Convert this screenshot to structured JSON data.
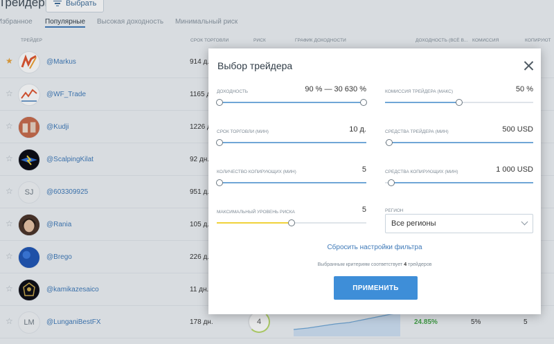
{
  "page": {
    "title": "Трейдеры",
    "choose_button": "Выбрать",
    "tabs": [
      "Избранное",
      "Популярные",
      "Высокая доходность",
      "Минимальный риск"
    ],
    "active_tab": "Популярные",
    "columns": [
      "ТРЕЙДЕР",
      "СРОК ТОРГОВЛИ",
      "РИСК",
      "ГРАФИК ДОХОДНОСТИ",
      "ДОХОДНОСТЬ (ВСЁ В...",
      "КОМИССИЯ",
      "КОПИРУЮТ"
    ],
    "traders": [
      {
        "name": "@Markus",
        "days": "914 д.",
        "favorite": true
      },
      {
        "name": "@WF_Trade",
        "days": "1165 д.",
        "favorite": false
      },
      {
        "name": "@Kudji",
        "days": "1226 д.",
        "favorite": false
      },
      {
        "name": "@ScalpingKilat",
        "days": "92 дн.",
        "favorite": false
      },
      {
        "name": "@603309925",
        "days": "951 д.",
        "favorite": false,
        "initials": "SJ"
      },
      {
        "name": "@Rania",
        "days": "105 д.",
        "favorite": false
      },
      {
        "name": "@Brego",
        "days": "226 д.",
        "favorite": false
      },
      {
        "name": "@kamikazesaico",
        "days": "11 дн.",
        "favorite": false
      },
      {
        "name": "@LunganiBestFX",
        "days": "178 дн.",
        "favorite": false,
        "initials": "LM",
        "risk": "4",
        "yield": "24.85%",
        "commission": "5%",
        "copiers": "5"
      }
    ]
  },
  "modal": {
    "title": "Выбор трейдера",
    "filters": {
      "yield": {
        "label": "ДОХОДНОСТЬ",
        "value": "90 % — 30 630 %",
        "low": 0.0,
        "high": 1.0
      },
      "commission": {
        "label": "КОМИССИЯ ТРЕЙДЕРА (МАКС)",
        "value": "50 %",
        "level": 0.5
      },
      "period": {
        "label": "СРОК ТОРГОВЛИ (МИН)",
        "value": "10 д.",
        "level": 0.0
      },
      "trader_funds": {
        "label": "СРЕДСТВА ТРЕЙДЕРА (МИН)",
        "value": "500 USD",
        "level": 0.02
      },
      "copiers": {
        "label": "КОЛИЧЕСТВО КОПИРУЮЩИХ (МИН)",
        "value": "5",
        "level": 0.0
      },
      "copier_funds": {
        "label": "СРЕДСТВА КОПИРУЮЩИХ (МИН)",
        "value": "1 000 USD",
        "level": 0.04
      },
      "risk": {
        "label": "МАКСИМАЛЬНЫЙ УРОВЕНЬ РИСКА",
        "value": "5",
        "level": 0.5
      }
    },
    "region": {
      "label": "РЕГИОН",
      "value": "Все регионы"
    },
    "reset_label": "Сбросить настройки фильтра",
    "match_prefix": "Выбранным критериям соответствует",
    "match_count": "4",
    "match_suffix": "трейдеров",
    "apply_label": "ПРИМЕНИТЬ"
  },
  "colors": {
    "accent": "#3e8ed8",
    "link": "#3e79b8",
    "favorite": "#e8a23a",
    "yield_positive": "#43a447",
    "risk_slider": "#f0d23a"
  }
}
